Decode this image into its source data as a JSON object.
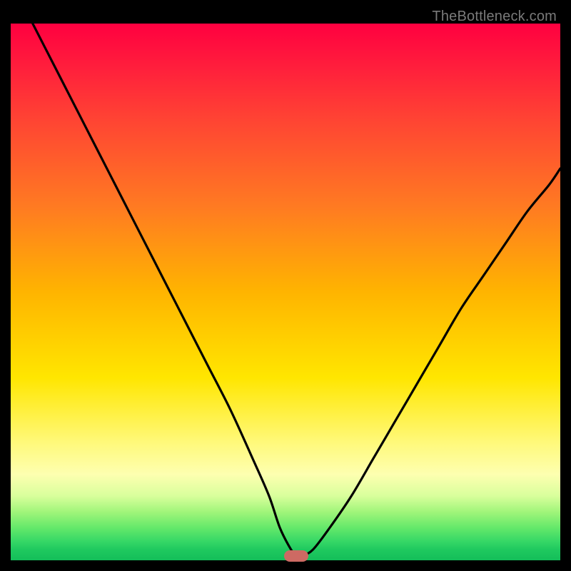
{
  "watermark": "TheBottleneck.com",
  "colors": {
    "frame_bg": "#000000",
    "curve_stroke": "#000000",
    "marker_fill": "#cd6a63",
    "watermark_text": "#7a7a7a"
  },
  "chart_data": {
    "type": "line",
    "title": "",
    "xlabel": "",
    "ylabel": "",
    "xlim": [
      0,
      100
    ],
    "ylim": [
      0,
      100
    ],
    "grid": false,
    "legend": false,
    "description": "Bottleneck-style V-curve over a vertical red→yellow→green gradient. Y≈100 means worst (top, red), Y≈0 means best (bottom, green). The curve dips to ~0 near x≈52 where a small rounded marker sits.",
    "series": [
      {
        "name": "bottleneck-curve",
        "x": [
          0,
          4,
          8,
          12,
          16,
          20,
          24,
          28,
          32,
          36,
          40,
          44,
          47,
          49,
          51,
          52,
          53,
          55,
          58,
          62,
          66,
          70,
          74,
          78,
          82,
          86,
          90,
          94,
          98,
          100
        ],
        "y": [
          108,
          100,
          92,
          84,
          76,
          68,
          60,
          52,
          44,
          36,
          28,
          19,
          12,
          6,
          2,
          0.8,
          0.8,
          2,
          6,
          12,
          19,
          26,
          33,
          40,
          47,
          53,
          59,
          65,
          70,
          73
        ]
      }
    ],
    "marker": {
      "x": 52,
      "y": 0.8
    },
    "gradient_stops": [
      {
        "pct": 0,
        "color": "#ff0040"
      },
      {
        "pct": 50,
        "color": "#ffb400"
      },
      {
        "pct": 66,
        "color": "#ffe600"
      },
      {
        "pct": 100,
        "color": "#14be59"
      }
    ]
  }
}
